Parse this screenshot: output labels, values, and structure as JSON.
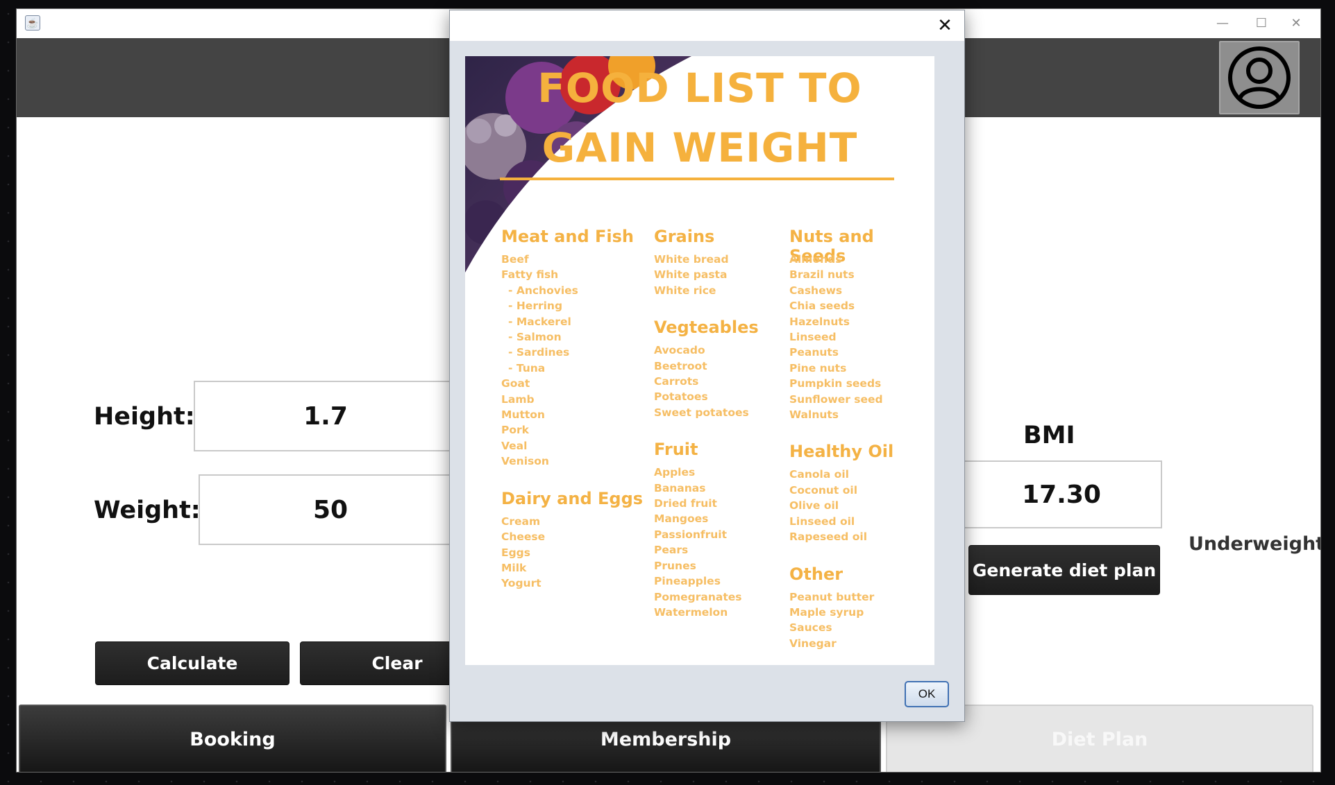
{
  "window": {
    "app_icon": "java-cup-icon",
    "controls": {
      "minimize": "—",
      "maximize": "☐",
      "close": "✕"
    },
    "avatar_icon": "user-profile-icon"
  },
  "form": {
    "height_label": "Height:",
    "height_value": "1.7",
    "weight_label": "Weight:",
    "weight_value": "50",
    "calculate_label": "Calculate",
    "clear_label": "Clear",
    "bmi_label": "BMI",
    "bmi_value": "17.30",
    "status": "Underweight",
    "generate_label": "Generate diet plan"
  },
  "nav": {
    "booking": "Booking",
    "membership": "Membership",
    "diet_plan": "Diet Plan"
  },
  "dialog": {
    "close_glyph": "✕",
    "ok_label": "OK",
    "poster": {
      "title_line1": "FOOD LIST TO",
      "title_line2": "GAIN WEIGHT",
      "columns": [
        {
          "groups": [
            {
              "name": "Meat and Fish",
              "items": [
                "Beef",
                "Fatty fish",
                "- Anchovies",
                "- Herring",
                "- Mackerel",
                "- Salmon",
                "- Sardines",
                "- Tuna",
                "Goat",
                "Lamb",
                "Mutton",
                "Pork",
                "Veal",
                "Venison"
              ]
            },
            {
              "name": "Dairy and Eggs",
              "items": [
                "Cream",
                "Cheese",
                "Eggs",
                "Milk",
                "Yogurt"
              ]
            }
          ]
        },
        {
          "groups": [
            {
              "name": "Grains",
              "items": [
                "White bread",
                "White pasta",
                "White rice"
              ]
            },
            {
              "name": "Vegteables",
              "items": [
                "Avocado",
                "Beetroot",
                "Carrots",
                "Potatoes",
                "Sweet potatoes"
              ]
            },
            {
              "name": "Fruit",
              "items": [
                "Apples",
                "Bananas",
                "Dried fruit",
                "Mangoes",
                "Passionfruit",
                "Pears",
                "Prunes",
                "Pineapples",
                "Pomegranates",
                "Watermelon"
              ]
            }
          ]
        },
        {
          "groups": [
            {
              "name": "Nuts and Seeds",
              "items": [
                "Almonds",
                "Brazil nuts",
                "Cashews",
                "Chia seeds",
                "Hazelnuts",
                "Linseed",
                "Peanuts",
                "Pine nuts",
                "Pumpkin seeds",
                "Sunflower seed",
                "Walnuts"
              ]
            },
            {
              "name": "Healthy Oil",
              "items": [
                "Canola oil",
                "Coconut oil",
                "Olive oil",
                "Linseed oil",
                "Rapeseed oil"
              ]
            },
            {
              "name": "Other",
              "items": [
                "Peanut butter",
                "Maple syrup",
                "Sauces",
                "Vinegar"
              ]
            }
          ]
        }
      ]
    }
  }
}
